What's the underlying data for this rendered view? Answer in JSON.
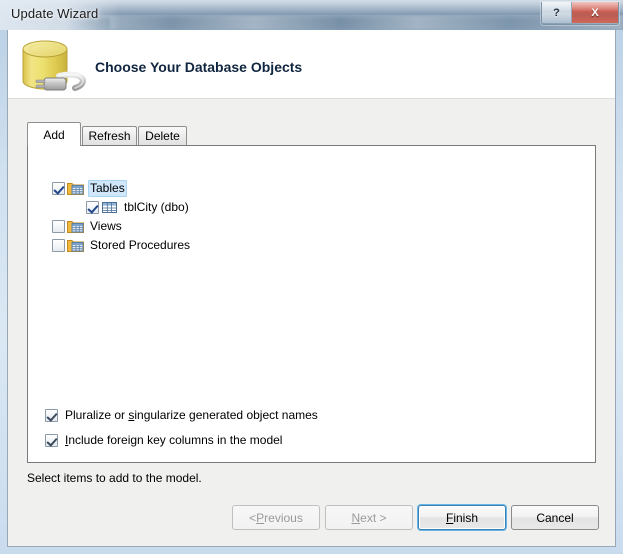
{
  "window": {
    "title": "Update Wizard",
    "caption_buttons": [
      {
        "name": "help-button",
        "glyph": "?"
      },
      {
        "name": "close-button",
        "glyph": "X"
      }
    ]
  },
  "banner": {
    "title": "Choose Your Database Objects",
    "icon": "database-plug-icon"
  },
  "tabs": [
    {
      "label": "Add",
      "selected": true
    },
    {
      "label": "Refresh",
      "selected": false
    },
    {
      "label": "Delete",
      "selected": false
    }
  ],
  "tree": [
    {
      "label": "Tables",
      "checked": true,
      "level": 0,
      "icon": "tables-folder-icon",
      "expanded": true,
      "selected": true
    },
    {
      "label": "tblCity (dbo)",
      "checked": true,
      "level": 1,
      "icon": "table-grid-icon",
      "expanded": null,
      "selected": false
    },
    {
      "label": "Views",
      "checked": false,
      "level": 0,
      "icon": "views-folder-icon",
      "expanded": null,
      "selected": false
    },
    {
      "label": "Stored Procedures",
      "checked": false,
      "level": 0,
      "icon": "stored-procedures-folder-icon",
      "expanded": null,
      "selected": false
    }
  ],
  "options": [
    {
      "name": "pluralize-checkbox",
      "checked": true,
      "prefix": "Pluralize or ",
      "accel": "s",
      "suffix": "ingularize generated object names"
    },
    {
      "name": "include-foreign-keys-checkbox",
      "checked": true,
      "prefix": "",
      "accel": "I",
      "suffix": "nclude foreign key columns in the model"
    }
  ],
  "status": "Select items to add to the model.",
  "buttons": [
    {
      "name": "previous-button",
      "prefix": "< ",
      "accel": "P",
      "suffix": "revious",
      "disabled": true,
      "default": false
    },
    {
      "name": "next-button",
      "prefix": "",
      "accel": "N",
      "suffix": "ext >",
      "disabled": true,
      "default": false
    },
    {
      "name": "finish-button",
      "prefix": "",
      "accel": "F",
      "suffix": "inish",
      "disabled": false,
      "default": true
    },
    {
      "name": "cancel-button",
      "prefix": "",
      "accel": "",
      "suffix": "Cancel",
      "disabled": false,
      "default": false
    }
  ],
  "colors": {
    "accent": "#3c7fb1",
    "focus_glow": "#68b5e8",
    "close_red": "#c4483a",
    "selection_blue": "#cfe6fb"
  }
}
